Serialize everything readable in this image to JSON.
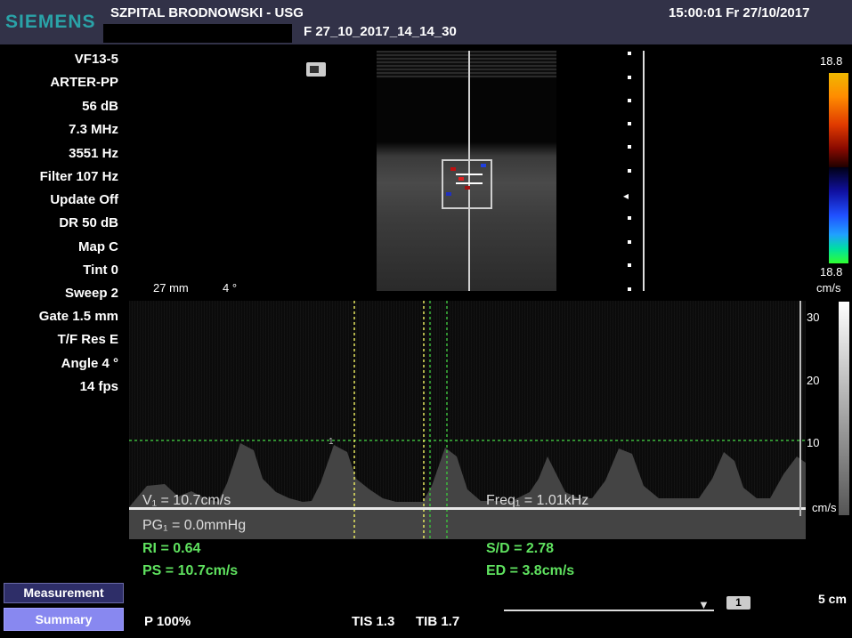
{
  "header": {
    "logo": "SIEMENS",
    "hospital": "SZPITAL BRODNOWSKI - USG",
    "file_id": "F   27_10_2017_14_14_30",
    "datetime": "15:00:01  Fr  27/10/2017"
  },
  "params": [
    "VF13-5",
    "ARTER-PP",
    "56 dB",
    "7.3 MHz",
    "3551 Hz",
    "Filter 107 Hz",
    "Update Off",
    "DR 50 dB",
    "Map C",
    "Tint 0",
    "Sweep 2",
    "Gate 1.5 mm",
    "T/F Res E",
    "Angle 4 °",
    "14 fps"
  ],
  "image": {
    "depth": "27 mm",
    "angle": "4 °",
    "color_max": "18.8",
    "color_min": "18.8",
    "color_unit": "cm/s"
  },
  "spectral": {
    "scale_labels": [
      "30",
      "20",
      "10"
    ],
    "scale_unit": "cm/s",
    "v1": "V₁ = 10.7cm/s",
    "freq1": "Freq₁ = 1.01kHz",
    "pg1": "PG₁ = 0.0mmHg"
  },
  "measurements": {
    "ri": "RI = 0.64",
    "ps": "PS = 10.7cm/s",
    "sd": "S/D = 2.78",
    "ed": "ED = 3.8cm/s"
  },
  "buttons": {
    "measurement": "Measurement",
    "summary": "Summary"
  },
  "footer": {
    "power": "P 100%",
    "tis": "TIS 1.3",
    "tib": "TIB 1.7",
    "page": "1",
    "scale": "5 cm"
  },
  "colors": {
    "header_bg": "#323248",
    "logo": "#2aa3a8",
    "measurement_green": "#5fe25f",
    "caliper_yellow": "#e8e860",
    "caliper_green": "#40c040"
  }
}
